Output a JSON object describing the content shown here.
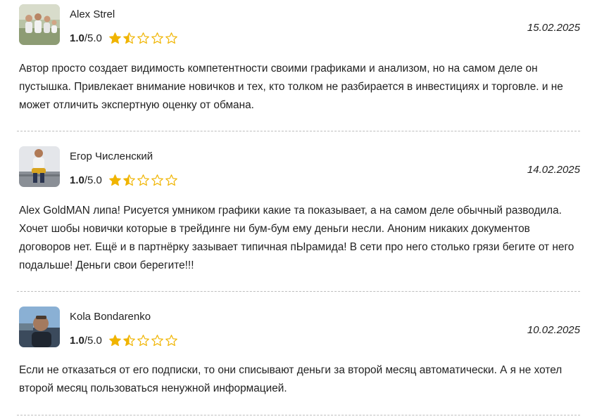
{
  "reviews": [
    {
      "author": "Alex Strel",
      "rating_value": "1.0",
      "rating_max": "/5.0",
      "stars_filled": 1.5,
      "date": "15.02.2025",
      "text": "Автор просто создает видимость компетентности своими графиками и анализом, но на самом деле он пустышка. Привлекает внимание новичков и тех, кто толком не разбирается в инвестициях и торговле. и не может отличить экспертную оценку от обмана."
    },
    {
      "author": "Егор Численский",
      "rating_value": "1.0",
      "rating_max": "/5.0",
      "stars_filled": 1.5,
      "date": "14.02.2025",
      "text": "Alex GoldMAN липа! Рисуется умником графики какие та показывает, а на самом деле обычный разводила. Хочет шобы новички которые в трейдинге ни бум-бум ему деньги несли. Аноним никаких документов договоров нет. Ещё и в партнёрку зазывает типичная пЫрамида! В сети про него столько грязи бегите от него подальше! Деньги свои берегите!!!"
    },
    {
      "author": "Kola Bondarenko",
      "rating_value": "1.0",
      "rating_max": "/5.0",
      "stars_filled": 1.5,
      "date": "10.02.2025",
      "text": "Если не отказаться от его подписки, то они списывают деньги за второй месяц автоматически. А я не хотел второй месяц пользоваться ненужной информацией."
    }
  ],
  "colors": {
    "star": "#f0b400",
    "divider": "#bdbdbd",
    "text": "#222222"
  }
}
